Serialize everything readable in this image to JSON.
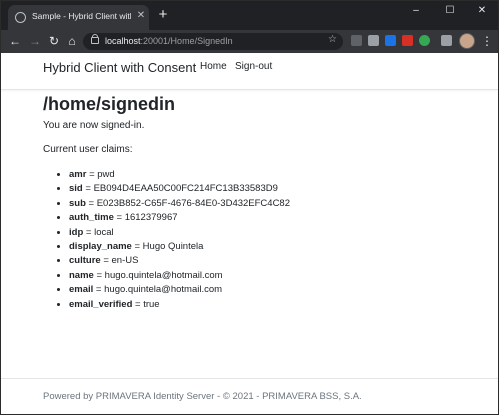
{
  "browser": {
    "tab_title": "Sample - Hybrid Client with Cons",
    "tab_close": "✕",
    "new_tab": "+",
    "url_host": "localhost",
    "url_path": ":20001/Home/SignedIn",
    "window_controls": {
      "minimize": "–",
      "maximize": "☐",
      "close": "✕"
    },
    "icons": {
      "back": "back-arrow-icon",
      "forward": "forward-arrow-icon",
      "reload": "reload-icon",
      "home": "home-icon",
      "lock": "lock-icon",
      "star": "star-icon",
      "menu": "three-dots-icon"
    },
    "extension_colors": [
      "#5f6368",
      "#9aa0a6",
      "#1a73e8",
      "#d93025",
      "#34a853",
      "#34a853",
      "#9aa0a6"
    ]
  },
  "navbar": {
    "brand": "Hybrid Client with Consent",
    "links": [
      {
        "label": "Home"
      },
      {
        "label": "Sign-out"
      }
    ]
  },
  "main": {
    "title": "/home/signedin",
    "message": "You are now signed-in.",
    "claims_heading": "Current user claims:",
    "claims": [
      {
        "key": "amr",
        "value": "pwd"
      },
      {
        "key": "sid",
        "value": "EB094D4EAA50C00FC214FC13B33583D9"
      },
      {
        "key": "sub",
        "value": "E023B852-C65F-4676-84E0-3D432EFC4C82"
      },
      {
        "key": "auth_time",
        "value": "1612379967"
      },
      {
        "key": "idp",
        "value": "local"
      },
      {
        "key": "display_name",
        "value": "Hugo Quintela"
      },
      {
        "key": "culture",
        "value": "en-US"
      },
      {
        "key": "name",
        "value": "hugo.quintela@hotmail.com"
      },
      {
        "key": "email",
        "value": "hugo.quintela@hotmail.com"
      },
      {
        "key": "email_verified",
        "value": "true"
      }
    ],
    "separator": " = "
  },
  "footer": {
    "text": "Powered by PRIMAVERA Identity Server - © 2021 - PRIMAVERA BSS, S.A."
  }
}
